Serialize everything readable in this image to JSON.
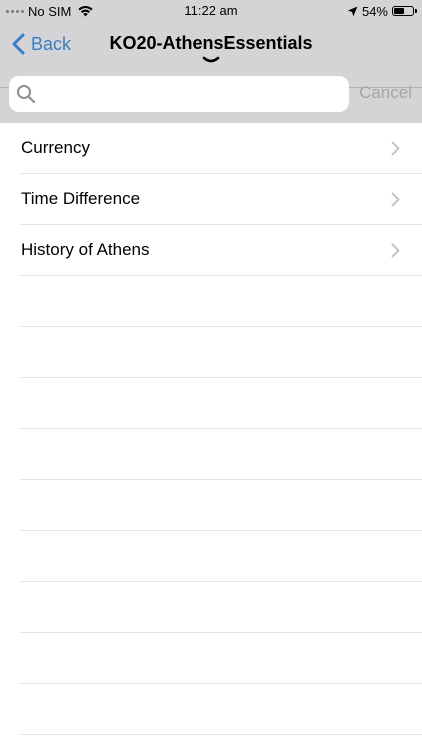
{
  "status_bar": {
    "carrier": "No SIM",
    "time": "11:22 am",
    "battery_percent": "54%",
    "battery_level": 0.54,
    "icons": [
      "signal-dots-icon",
      "wifi-icon",
      "location-arrow-icon",
      "battery-icon"
    ]
  },
  "nav": {
    "back_label": "Back",
    "title": "KO20-AthensEssentials",
    "icons": [
      "chevron-left-icon",
      "chevron-down-icon"
    ]
  },
  "search": {
    "value": "",
    "placeholder": "",
    "cancel_label": "Cancel",
    "icon": "search-icon"
  },
  "list": {
    "items": [
      {
        "label": "Currency"
      },
      {
        "label": "Time Difference"
      },
      {
        "label": "History of Athens"
      }
    ],
    "row_icon": "chevron-right-icon"
  },
  "colors": {
    "accent": "#3b7ec3",
    "header_background": "#d4d4d6",
    "cancel_text": "#a5a5a8",
    "separator": "#e4e4e6"
  }
}
